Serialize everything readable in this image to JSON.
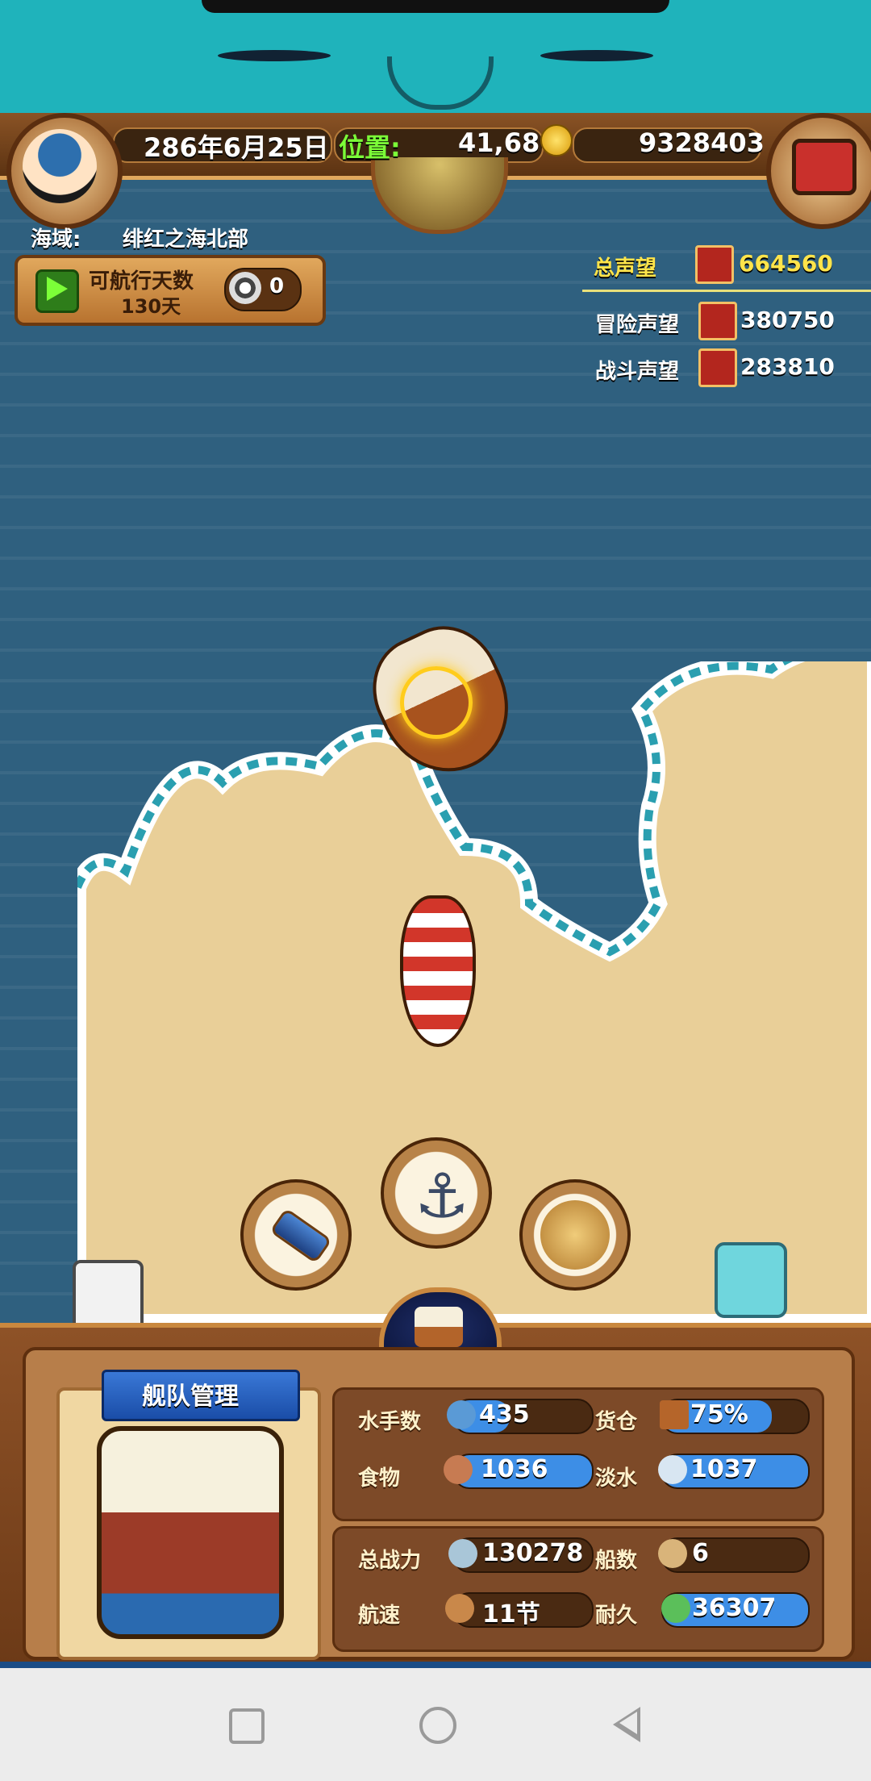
{
  "status": {
    "date": "286年6月25日",
    "position_label": "位置:",
    "position_value": "41,68",
    "gold": "9328403",
    "sea_area_label": "海域:",
    "sea_area_value": "绯红之海北部"
  },
  "sail": {
    "label": "可航行天数",
    "days": "130天",
    "coins": "0"
  },
  "reputation": {
    "total": {
      "label": "总声望",
      "value": "664560"
    },
    "adventure": {
      "label": "冒险声望",
      "value": "380750"
    },
    "battle": {
      "label": "战斗声望",
      "value": "283810"
    }
  },
  "actions": {
    "spyglass": "spyglass-icon",
    "anchor": "anchor-icon",
    "map": "world-map-icon",
    "ship": "ship-icon"
  },
  "fleet": {
    "title": "舰队管理",
    "stats": {
      "sailors": {
        "label": "水手数",
        "value": "435"
      },
      "cargo": {
        "label": "货仓",
        "value": "75%",
        "fill_percent": 75
      },
      "food": {
        "label": "食物",
        "value": "1036"
      },
      "water": {
        "label": "淡水",
        "value": "1037"
      },
      "power": {
        "label": "总战力",
        "value": "130278"
      },
      "ships": {
        "label": "船数",
        "value": "6"
      },
      "speed": {
        "label": "航速",
        "value": "11节"
      },
      "durability": {
        "label": "耐久",
        "value": "36307"
      }
    }
  },
  "colors": {
    "sea": "#2f607f",
    "sand": "#e9cf98",
    "banner": "#1fb3bb",
    "accent_green": "#7cff38",
    "accent_yellow": "#ffe44a"
  }
}
